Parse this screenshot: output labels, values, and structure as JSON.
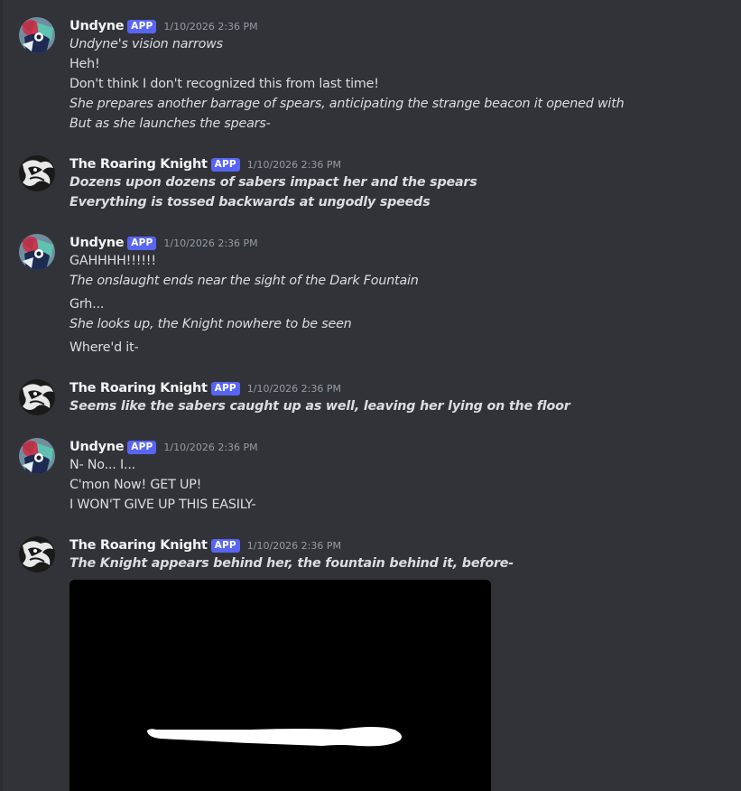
{
  "channel": {
    "messages": [
      {
        "author": "Undyne",
        "badge": "APP",
        "timestamp": "1/10/2026 2:36 PM",
        "avatar_icon": "undyne-avatar-icon",
        "lines": [
          {
            "text": "Undyne's vision narrows",
            "style": "italic"
          },
          {
            "text": "Heh!",
            "style": "normal"
          },
          {
            "text": "Don't think I don't recognized this from last time!",
            "style": "normal"
          },
          {
            "text": "She prepares another barrage of spears, anticipating the strange beacon it opened with",
            "style": "italic"
          },
          {
            "text": "But as she launches the spears-",
            "style": "italic"
          }
        ]
      },
      {
        "author": "The Roaring Knight",
        "badge": "APP",
        "timestamp": "1/10/2026 2:36 PM",
        "avatar_icon": "roaring-knight-avatar-icon",
        "lines": [
          {
            "text": "Dozens upon dozens of sabers impact her and the spears",
            "style": "bold-italic"
          },
          {
            "text": "Everything is tossed backwards at ungodly speeds",
            "style": "bold-italic"
          }
        ]
      },
      {
        "author": "Undyne",
        "badge": "APP",
        "timestamp": "1/10/2026 2:36 PM",
        "avatar_icon": "undyne-avatar-icon",
        "lines": [
          {
            "text": "GAHHHH!!!!!!",
            "style": "normal"
          },
          {
            "text": "The onslaught ends near the sight of the Dark Fountain",
            "style": "italic"
          },
          {
            "text": "Grh...",
            "style": "normal"
          },
          {
            "text": "She looks up, the Knight nowhere to be seen",
            "style": "italic"
          },
          {
            "text": "Where'd it-",
            "style": "normal"
          }
        ]
      },
      {
        "author": "The Roaring Knight",
        "badge": "APP",
        "timestamp": "1/10/2026 2:36 PM",
        "avatar_icon": "roaring-knight-avatar-icon",
        "lines": [
          {
            "text": "Seems like the sabers caught up as well, leaving her lying on the floor",
            "style": "bold-italic"
          }
        ]
      },
      {
        "author": "Undyne",
        "badge": "APP",
        "timestamp": "1/10/2026 2:36 PM",
        "avatar_icon": "undyne-avatar-icon",
        "lines": [
          {
            "text": "N- No... I...",
            "style": "normal"
          },
          {
            "text": "C'mon Now! GET UP!",
            "style": "normal"
          },
          {
            "text": "I WON'T GIVE UP THIS EASILY-",
            "style": "normal"
          }
        ]
      },
      {
        "author": "The Roaring Knight",
        "badge": "APP",
        "timestamp": "1/10/2026 2:36 PM",
        "avatar_icon": "roaring-knight-avatar-icon",
        "lines": [
          {
            "text": "The Knight appears behind her, the fountain behind it, before-",
            "style": "bold-italic"
          }
        ],
        "attachment": {
          "type": "image",
          "description_icon": "sword-slash-image"
        }
      }
    ]
  },
  "colors": {
    "background": "#323339",
    "username": "#f2f3f5",
    "badge": "#5865f2",
    "timestamp": "#949ba4",
    "text": "#dbdee1"
  }
}
